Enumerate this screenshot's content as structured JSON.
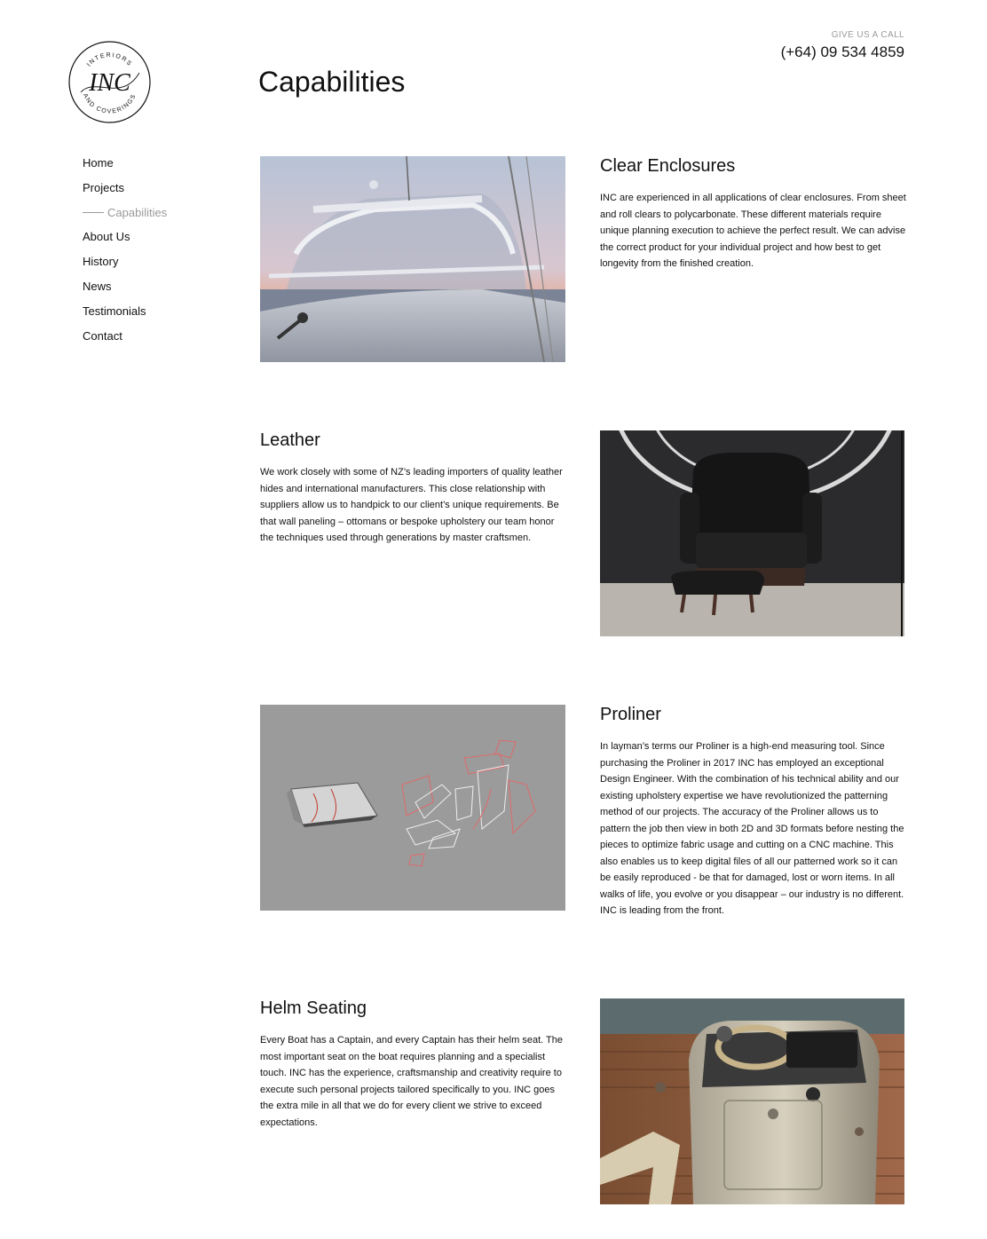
{
  "brand": {
    "name": "INC",
    "ring_top": "INTERIORS",
    "ring_bottom": "AND COVERINGS"
  },
  "header": {
    "call_label": "GIVE US A CALL",
    "phone": "(+64) 09 534 4859"
  },
  "page": {
    "title": "Capabilities"
  },
  "nav": {
    "items": [
      {
        "label": "Home",
        "active": false
      },
      {
        "label": "Projects",
        "active": false
      },
      {
        "label": "Capabilities",
        "active": true
      },
      {
        "label": "About Us",
        "active": false
      },
      {
        "label": "History",
        "active": false
      },
      {
        "label": "News",
        "active": false
      },
      {
        "label": "Testimonials",
        "active": false
      },
      {
        "label": "Contact",
        "active": false
      }
    ]
  },
  "sections": [
    {
      "title": "Clear Enclosures",
      "text": "INC are experienced in all applications of clear enclosures. From sheet and roll clears to polycarbonate. These different materials require unique planning execution to achieve the perfect result. We can advise the correct product for your individual project and how best to get longevity from the finished creation."
    },
    {
      "title": "Leather",
      "text": "We work closely with some of NZ’s leading importers of quality leather hides and international manufacturers. This close relationship with suppliers allow us to handpick to our client’s unique requirements. Be that wall paneling – ottomans or bespoke upholstery our team honor the techniques used through generations by master craftsmen."
    },
    {
      "title": "Proliner",
      "text": "In layman’s terms our Proliner is a high-end measuring tool. Since purchasing the Proliner in 2017 INC has employed an exceptional Design Engineer.  With the combination of his technical ability and our existing upholstery expertise we have revolutionized the patterning method of our projects. The accuracy of the Proliner allows us to pattern the job then view in both 2D and 3D formats before nesting the pieces to optimize fabric usage and cutting on a CNC machine. This also enables us to keep digital files of all our patterned work so it can be easily reproduced - be that for damaged, lost or worn items. In all walks of life, you evolve or you disappear – our industry is no different. INC is leading from the front."
    },
    {
      "title": "Helm Seating",
      "text": "Every Boat has a Captain, and every Captain has their helm seat. The most important seat on the boat requires planning and a specialist touch. INC has the experience, craftsmanship and creativity require to execute such personal projects tailored specifically to you. INC goes the extra mile in all that we do for every client we strive to exceed expectations."
    }
  ]
}
